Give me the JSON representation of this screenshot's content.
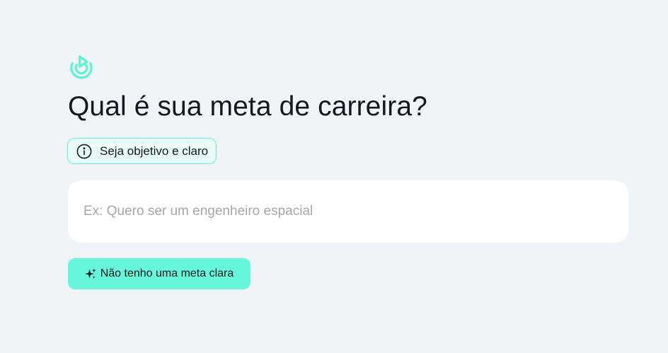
{
  "header": {
    "logo_icon": "target-play-logo-icon",
    "title": "Qual é sua meta de carreira?"
  },
  "hint": {
    "icon": "info-icon",
    "text": "Seja objetivo e claro"
  },
  "goal_input": {
    "value": "",
    "placeholder": "Ex: Quero ser um engenheiro espacial"
  },
  "no_goal_button": {
    "icon": "sparkles-icon",
    "label": "Não tenho uma meta clara"
  },
  "colors": {
    "accent": "#66f7da",
    "accent_border": "#5ef2d5",
    "background": "#f0f4f7",
    "text": "#15181c",
    "placeholder": "#a3a7ab"
  }
}
